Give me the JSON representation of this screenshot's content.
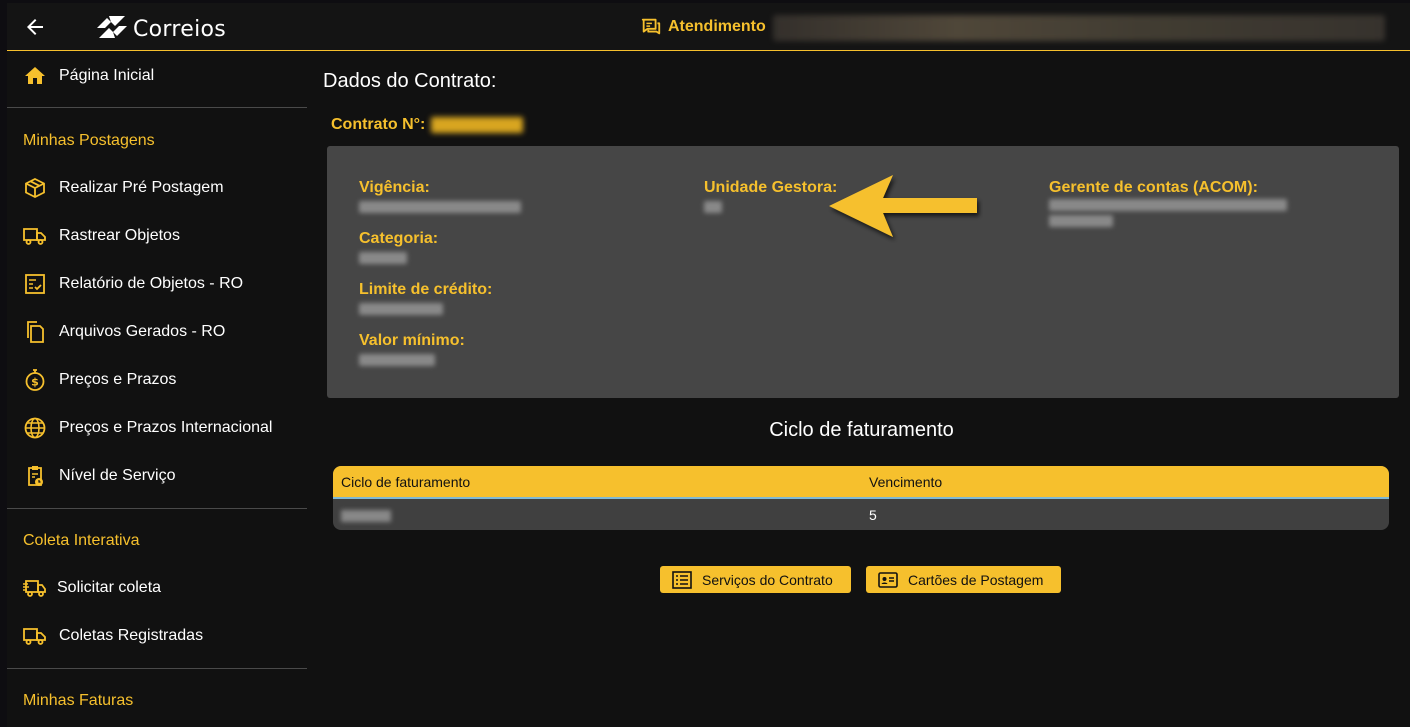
{
  "header": {
    "logo_text": "Correios",
    "attendance_label": "Atendimento"
  },
  "sidebar": {
    "home": "Página Inicial",
    "sections": [
      {
        "title": "Minhas Postagens",
        "items": [
          {
            "label": "Realizar Pré Postagem",
            "icon": "package-icon"
          },
          {
            "label": "Rastrear Objetos",
            "icon": "truck-icon"
          },
          {
            "label": "Relatório de Objetos - RO",
            "icon": "report-icon"
          },
          {
            "label": "Arquivos Gerados - RO",
            "icon": "files-icon"
          },
          {
            "label": "Preços e Prazos",
            "icon": "money-stopwatch-icon"
          },
          {
            "label": "Preços e Prazos Internacional",
            "icon": "globe-icon"
          },
          {
            "label": "Nível de Serviço",
            "icon": "clipboard-clock-icon"
          }
        ]
      },
      {
        "title": "Coleta Interativa",
        "items": [
          {
            "label": "Solicitar coleta",
            "icon": "fast-truck-icon"
          },
          {
            "label": "Coletas Registradas",
            "icon": "truck-icon"
          }
        ]
      },
      {
        "title": "Minhas Faturas",
        "items": []
      }
    ]
  },
  "main": {
    "title": "Dados do Contrato:",
    "contract_label": "Contrato N°:",
    "fields": {
      "vigencia": "Vigência:",
      "categoria": "Categoria:",
      "limite": "Limite de crédito:",
      "valor_minimo": "Valor mínimo:",
      "unidade_gestora": "Unidade Gestora:",
      "gerente": "Gerente de contas (ACOM):"
    },
    "billing_title": "Ciclo de faturamento",
    "table": {
      "headers": [
        "Ciclo de faturamento",
        "Vencimento"
      ],
      "rows": [
        [
          "",
          "5"
        ]
      ]
    },
    "buttons": {
      "services": "Serviços do Contrato",
      "cards": "Cartões de Postagem"
    }
  },
  "colors": {
    "accent": "#f6c02d",
    "card_bg": "#464646",
    "page_bg": "#111111"
  }
}
